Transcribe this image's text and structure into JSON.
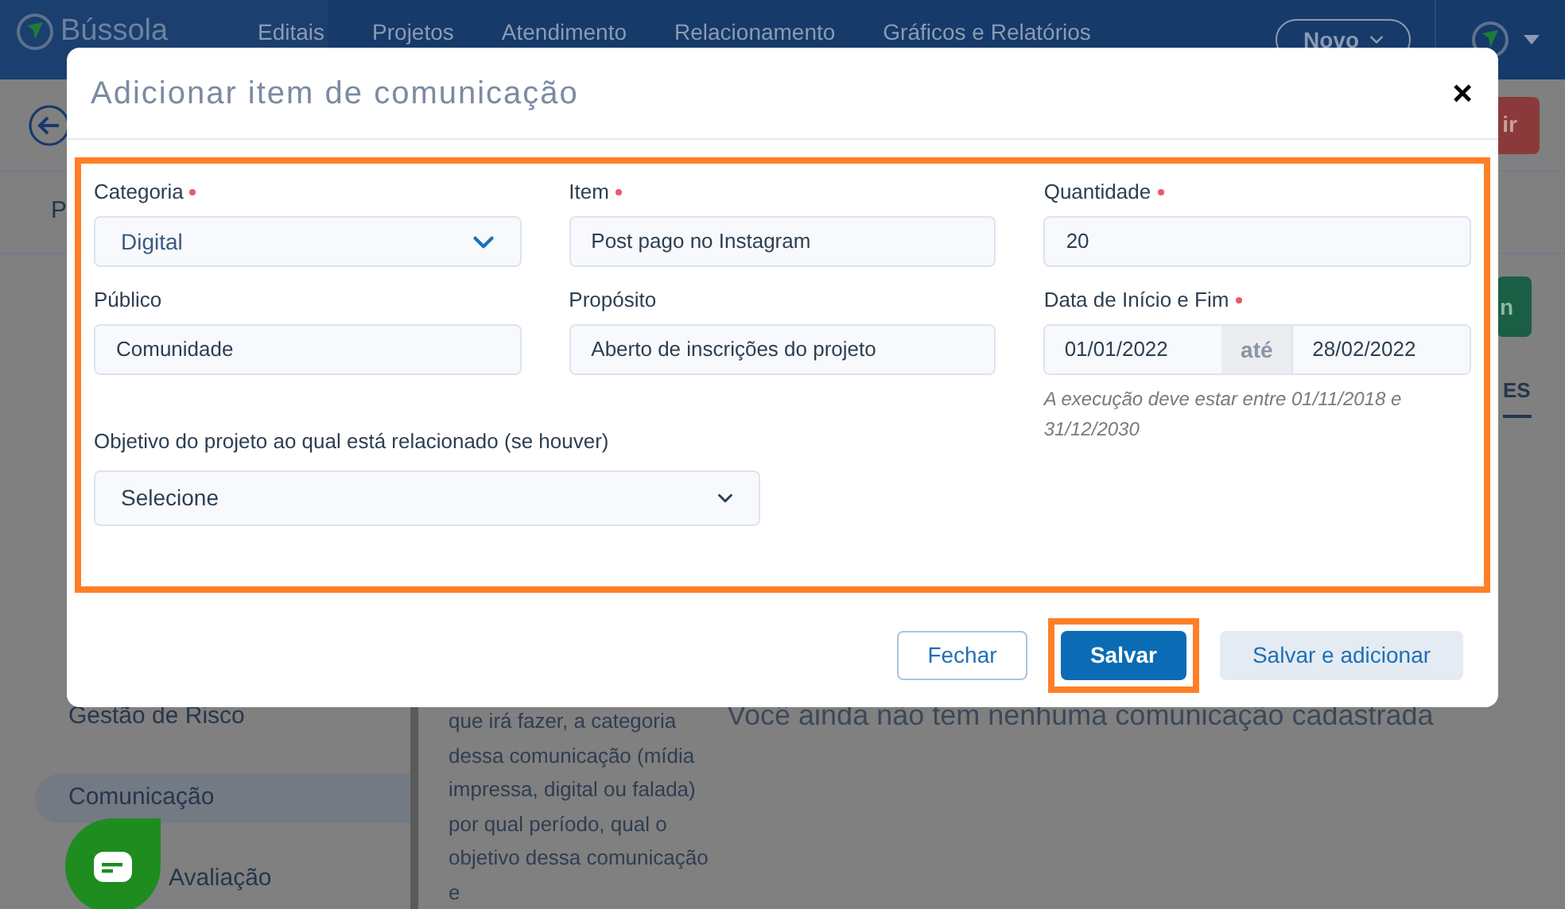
{
  "header": {
    "logo": "Bússola",
    "nav": [
      "Editais",
      "Projetos",
      "Atendimento",
      "Relacionamento",
      "Gráficos e Relatórios"
    ],
    "new_button": "Novo"
  },
  "page": {
    "tab_partial": "P",
    "red_button_partial": "ir",
    "green_button_partial": "n",
    "tab_right_partial": "ES",
    "sidebar": [
      {
        "label": "Gestão de Risco",
        "selected": false
      },
      {
        "label": "Comunicação",
        "selected": true
      },
      {
        "label": "Avaliação",
        "selected": false
      }
    ],
    "help_text": "que irá fazer, a categoria dessa comunicação (mídia impressa, digital ou falada) por qual período, qual o objetivo dessa comunicação e",
    "empty_message": "Você ainda não tem nenhuma comunicação cadastrada"
  },
  "modal": {
    "title": "Adicionar item de comunicação",
    "close": "×",
    "form_highlighted": true,
    "fields": [
      {
        "label": "Categoria",
        "required": true,
        "kind": "select",
        "value": "Digital"
      },
      {
        "label": "Item",
        "required": true,
        "kind": "text",
        "value": "Post pago no Instagram"
      },
      {
        "label": "Quantidade",
        "required": true,
        "kind": "text",
        "value": "20"
      },
      {
        "label": "Público",
        "required": false,
        "kind": "text",
        "value": "Comunidade"
      },
      {
        "label": "Propósito",
        "required": false,
        "kind": "text",
        "value": "Aberto de inscrições do projeto"
      },
      {
        "label": "Data de Início e Fim",
        "required": true,
        "kind": "daterange",
        "start": "01/01/2022",
        "separator": "até",
        "end": "28/02/2022",
        "hint": "A execução deve estar entre 01/11/2018 e 31/12/2030"
      }
    ],
    "objective": {
      "label": "Objetivo do projeto ao qual está relacionado (se houver)",
      "value": "Selecione"
    },
    "buttons": [
      {
        "label": "Fechar",
        "kind": "outline",
        "highlighted": false
      },
      {
        "label": "Salvar",
        "kind": "primary",
        "highlighted": true
      },
      {
        "label": "Salvar e adicionar",
        "kind": "secondary",
        "highlighted": false
      }
    ]
  }
}
